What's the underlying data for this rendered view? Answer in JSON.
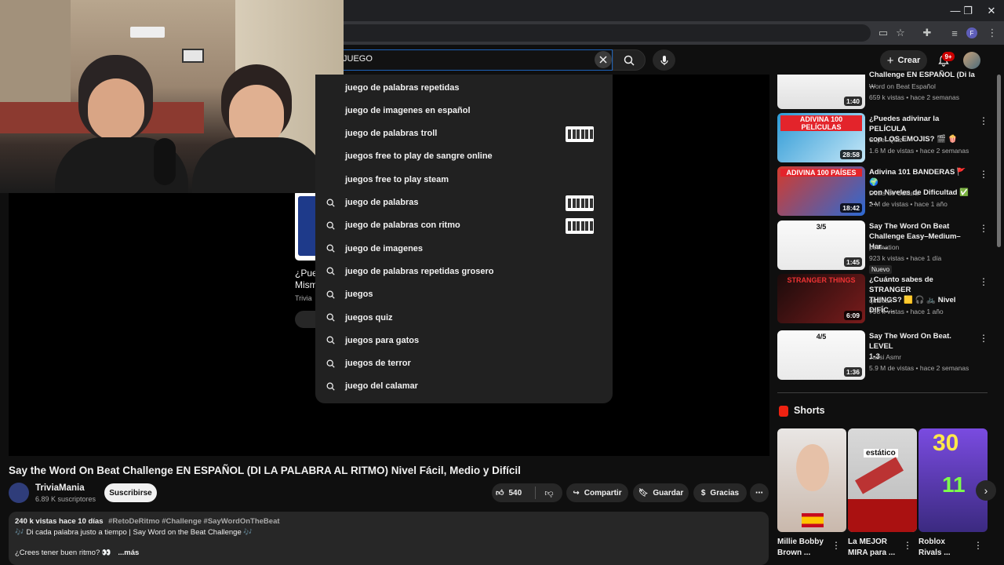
{
  "window": {
    "minimize": "—",
    "restore": "❐",
    "close": "✕"
  },
  "masthead": {
    "search_query": "JUEGO",
    "create_label": "Crear",
    "notif_count": "9+"
  },
  "suggestions": [
    {
      "text": "juego de palabras repetidas",
      "thumb": false
    },
    {
      "text": "juego de imagenes en español",
      "thumb": false
    },
    {
      "text": "juego de palabras troll",
      "thumb": true
    },
    {
      "text": "juegos free to play de sangre online",
      "thumb": false
    },
    {
      "text": "juegos free to play steam",
      "thumb": false
    },
    {
      "text": "juego de palabras",
      "thumb": true
    },
    {
      "text": "juego de palabras con ritmo",
      "thumb": true
    },
    {
      "text": "juego de imagenes",
      "thumb": false
    },
    {
      "text": "juego de palabras repetidas grosero",
      "thumb": false
    },
    {
      "text": "juegos",
      "thumb": false
    },
    {
      "text": "juegos quiz",
      "thumb": false
    },
    {
      "text": "juegos para gatos",
      "thumb": false
    },
    {
      "text": "juegos de terror",
      "thumb": false
    },
    {
      "text": "juego del calamar",
      "thumb": false
    }
  ],
  "player_ghost": {
    "line1": "¿Pue",
    "line2": "Mism",
    "channel": "Trivia"
  },
  "video": {
    "title": "Say the Word On Beat Challenge EN ESPAÑOL (DI LA PALABRA AL RITMO) Nivel Fácil, Medio y Difícil",
    "channel": "TriviaMania",
    "subscribers": "6.89 K suscriptores",
    "subscribe": "Suscribirse",
    "likes": "540",
    "share": "Compartir",
    "save": "Guardar",
    "thanks": "Gracias"
  },
  "description": {
    "stats": "240 k vistas  hace 10 días",
    "tags": "#RetoDeRitmo #Challenge #SayWordOnTheBeat",
    "line1": "🎶 Di cada palabra justo a tiempo | Say Word on the Beat Challenge 🎶",
    "line2": "¿Crees tener buen ritmo? 👀",
    "more": "...más"
  },
  "recommended": [
    {
      "title1": "Challenge EN ESPAÑOL (Di la ...",
      "title2": "",
      "channel": "Word on Beat Español",
      "meta": "659 k vistas • hace 2 semanas",
      "duration": "1:40",
      "badge": ""
    },
    {
      "title1": "¿Puedes adivinar la PELÍCULA",
      "title2": "con LOS EMOJIS? 🎬 🍿",
      "channel": "Super Quiz",
      "meta": "1.6 M de vistas • hace 2 semanas",
      "duration": "28:58",
      "badge": "",
      "thumb_text": "ADIVINA 100 PELÍCULAS"
    },
    {
      "title1": "Adivina 101 BANDERAS 🚩 🌍",
      "title2": "con Niveles de Dificultad ✅ -...",
      "channel": "Dosis de Cultura",
      "meta": "2 M de vistas • hace 1 año",
      "duration": "18:42",
      "badge": "",
      "thumb_text": "ADIVINA 100 PAÍSES"
    },
    {
      "title1": "Say The Word On Beat",
      "title2": "Challenge  Easy–Medium–Har...",
      "channel": "pollination",
      "meta": "923 k vistas • hace 1 día",
      "duration": "1:45",
      "badge": "Nuevo",
      "thumb_text": "3/5"
    },
    {
      "title1": "¿Cuánto sabes de STRANGER",
      "title2": "THINGS? 🟨 🎧 🚲  Nivel DIFÍC...",
      "channel": "quizear.",
      "meta": "798 k vistas • hace 1 año",
      "duration": "6:09",
      "badge": "",
      "thumb_text": "STRANGER THINGS"
    },
    {
      "title1": "Say The Word On Beat. LEVEL",
      "title2": "1-3",
      "channel": "Jassi Asmr",
      "meta": "5.9 M de vistas • hace 2 semanas",
      "duration": "1:36",
      "badge": "",
      "thumb_text": "4/5"
    }
  ],
  "shorts": {
    "heading": "Shorts",
    "items": [
      {
        "t1": "Millie Bobby",
        "t2": "Brown ..."
      },
      {
        "t1": "La MEJOR",
        "t2": "MIRA para ...",
        "overlay": "estático"
      },
      {
        "t1": "Roblox",
        "t2": "Rivals ...",
        "overlay": "30",
        "overlay2": "11"
      }
    ]
  },
  "colors": {
    "bg": "#0f0f0f",
    "accent_blue": "#1c62b9",
    "red": "#cc0000"
  }
}
